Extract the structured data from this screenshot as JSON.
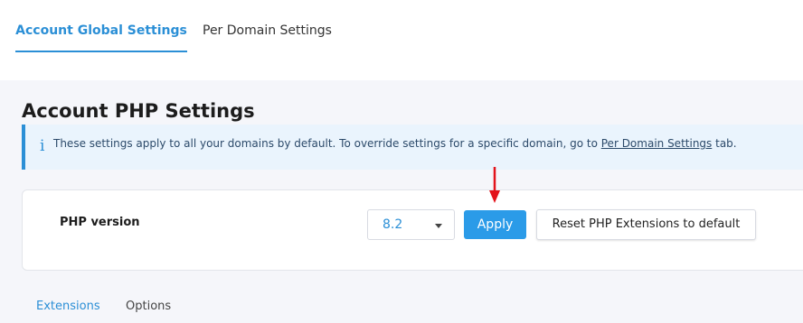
{
  "top_tabs": [
    {
      "label": "Account Global Settings",
      "active": true
    },
    {
      "label": "Per Domain Settings",
      "active": false
    }
  ],
  "page_title": "Account PHP Settings",
  "info": {
    "icon": "info-icon",
    "icon_glyph": "i",
    "text_before": "These settings apply to all your domains by default. To override settings for a specific domain, go to ",
    "link": "Per Domain Settings",
    "text_after": " tab."
  },
  "php": {
    "label": "PHP version",
    "selected_version": "8.2",
    "apply_label": "Apply",
    "reset_label": "Reset PHP Extensions to default"
  },
  "sub_tabs": [
    {
      "label": "Extensions",
      "active": true
    },
    {
      "label": "Options",
      "active": false
    }
  ],
  "colors": {
    "accent": "#2b8fd6",
    "apply_bg": "#2b9be8",
    "info_bg": "#eaf4fd",
    "page_bg": "#f5f6fa",
    "annotation_arrow": "#e3131b"
  }
}
